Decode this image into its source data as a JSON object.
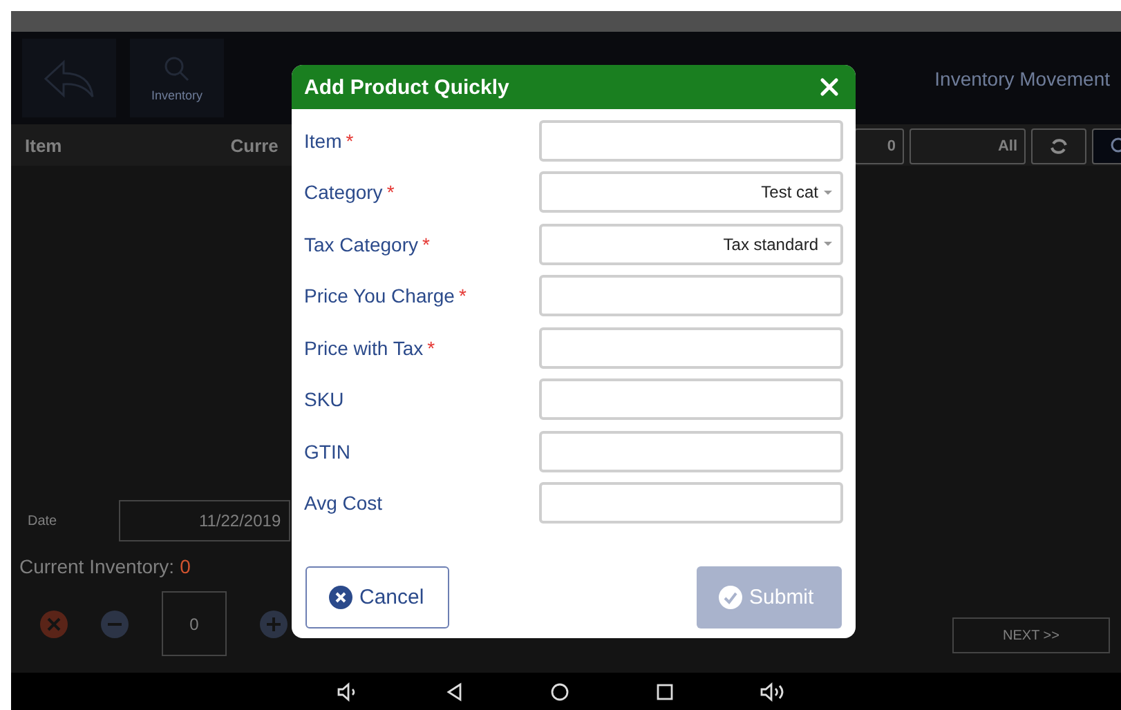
{
  "header": {
    "inventory_button": "Inventory",
    "title": "Inventory Movement"
  },
  "table": {
    "columns": [
      "Item",
      "Curre"
    ]
  },
  "filters": {
    "count": "0",
    "type": "All"
  },
  "date": {
    "label": "Date",
    "value": "11/22/2019"
  },
  "current_inventory": {
    "label": "Current Inventory:",
    "value": "0"
  },
  "quantity": {
    "value": "0"
  },
  "pager": {
    "next": "NEXT >>"
  },
  "dialog": {
    "title": "Add Product Quickly",
    "fields": [
      {
        "label": "Item",
        "mark": "*",
        "kind": "text"
      },
      {
        "label": "Category",
        "mark": "*",
        "kind": "select",
        "value": "Test cat"
      },
      {
        "label": "Tax Category",
        "mark": "*",
        "kind": "select",
        "value": "Tax standard"
      },
      {
        "label": "Price You Charge",
        "mark": "*",
        "kind": "text"
      },
      {
        "label": "Price with Tax",
        "mark": "*",
        "kind": "text"
      },
      {
        "label": "SKU",
        "kind": "text"
      },
      {
        "label": "GTIN",
        "kind": "text"
      },
      {
        "label": "Avg Cost",
        "kind": "text"
      }
    ],
    "cancel": {
      "label": "Cancel"
    },
    "submit": {
      "label": "Submit",
      "disabled": true
    }
  }
}
